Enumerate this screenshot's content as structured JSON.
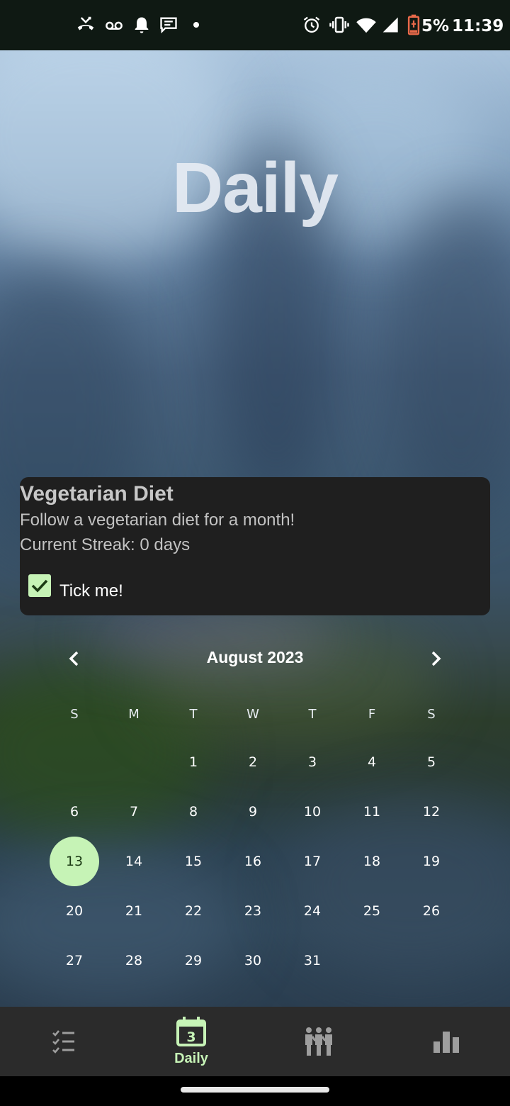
{
  "status_bar": {
    "battery": "5%",
    "time": "11:39",
    "left_icons": [
      "missed-call-icon",
      "voicemail-icon",
      "notification-bell-icon",
      "message-icon",
      "dot-icon"
    ],
    "right_icons": [
      "alarm-icon",
      "vibrate-icon",
      "wifi-icon",
      "cell-signal-icon",
      "battery-low-icon"
    ],
    "battery_color": "#e8694a"
  },
  "page": {
    "title": "Daily"
  },
  "habit_card": {
    "title": "Vegetarian Diet",
    "description": "Follow a vegetarian diet for a month!",
    "streak": "Current Streak: 0 days",
    "checkbox_label": "Tick me!",
    "checked": true
  },
  "calendar": {
    "month_label": "August 2023",
    "prev_icon": "chevron-left-icon",
    "next_icon": "chevron-right-icon",
    "weekdays": [
      "S",
      "M",
      "T",
      "W",
      "T",
      "F",
      "S"
    ],
    "first_weekday_index": 2,
    "days_in_month": 31,
    "selected_day": 13,
    "accent_color": "#c6f3b6"
  },
  "bottom_nav": {
    "items": [
      {
        "icon": "checklist-icon",
        "label": ""
      },
      {
        "icon": "calendar-day-icon",
        "label": "Daily",
        "badge": "3",
        "active": true
      },
      {
        "icon": "people-icon",
        "label": ""
      },
      {
        "icon": "bar-chart-icon",
        "label": ""
      }
    ],
    "active_color": "#c6f3b6",
    "inactive_color": "#9e9e9e"
  }
}
